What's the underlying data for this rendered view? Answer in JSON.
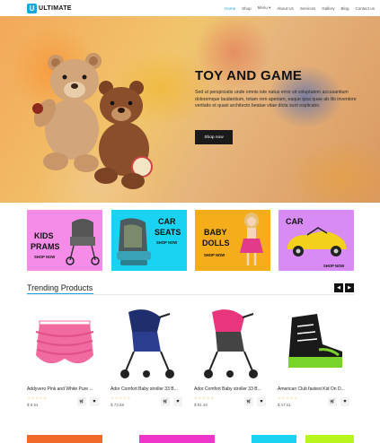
{
  "header": {
    "logo_letter": "U",
    "logo_text": "ULTIMATE",
    "nav": [
      "Home",
      "Shop",
      "Menu ▾",
      "About Us",
      "Services",
      "Gallery",
      "Blog",
      "Contact us"
    ]
  },
  "hero": {
    "title": "TOY AND GAME",
    "text": "Sed ut perspiciatis unde omnis iste natus error sit voluptatem accusantium doloremque laudantium, totam rem aperiam, eaque ipsa quae ab illo inventore veritatis et quasi architecto beatae vitae dicta sunt explicabo.",
    "button": "Shop now"
  },
  "categories": [
    {
      "line1": "KIDS",
      "line2": "PRAMS",
      "shop": "SHOP NOW",
      "color": "#f58de8"
    },
    {
      "line1": "CAR",
      "line2": "SEATS",
      "shop": "SHOP NOW",
      "color": "#1ad3f2"
    },
    {
      "line1": "BABY",
      "line2": "DOLLS",
      "shop": "SHOP NOW",
      "color": "#f5ad1c"
    },
    {
      "line1": "CAR",
      "line2": "",
      "shop": "SHOP NOW",
      "color": "#d88af5"
    }
  ],
  "trending": {
    "title": "Trending Products",
    "prev": "◀",
    "next": "▶",
    "products": [
      {
        "name": "Addyvero Pink and White Pure ...",
        "price": "$ 8.54"
      },
      {
        "name": "Ador Comfort Baby stroller 33 B...",
        "price": "$ 73.68"
      },
      {
        "name": "Ador Comfort Baby stroller 33 B...",
        "price": "$ 91.40"
      },
      {
        "name": "American Club fastest Kid On D...",
        "price": "$ 17.51"
      }
    ]
  },
  "icons": {
    "cart": "cart-icon",
    "heart": "heart-icon",
    "star": "star-icon"
  },
  "colors": {
    "accent": "#1aa6e0",
    "dark": "#111111",
    "bottom": [
      "#f26a2a",
      "#f036c8",
      "#1ad3f2",
      "#b7f51c"
    ]
  }
}
